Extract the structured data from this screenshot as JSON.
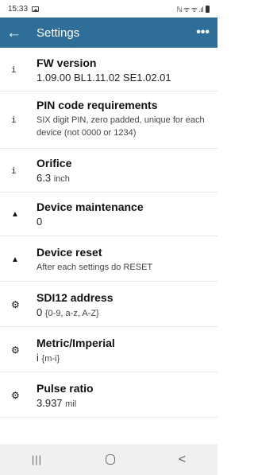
{
  "status_bar": {
    "time": "15:33",
    "right_text": "ℕ ᯤ ᯤ .ıl"
  },
  "app_bar": {
    "back_icon": "arrow-left-icon",
    "title": "Settings",
    "more_icon": "more-dots-icon",
    "more_label": "•••"
  },
  "items": [
    {
      "icon": "info-icon",
      "glyph": "i",
      "title": "FW version",
      "value": "1.09.00 BL1.11.02 SE1.02.01",
      "unit": ""
    },
    {
      "icon": "info-icon",
      "glyph": "i",
      "title": "PIN code requirements",
      "sub": "SIX digit PIN, zero padded, unique for each device (not 0000 or 1234)"
    },
    {
      "icon": "info-icon",
      "glyph": "i",
      "title": "Orifice",
      "value": "6.3",
      "unit": "inch"
    },
    {
      "icon": "warning-icon",
      "glyph": "▲",
      "title": "Device maintenance",
      "value": "0",
      "unit": ""
    },
    {
      "icon": "warning-icon",
      "glyph": "▲",
      "title": "Device reset",
      "sub": "After each settings do RESET"
    },
    {
      "icon": "gear-icon",
      "glyph": "⚙",
      "title": "SDI12 address",
      "value": "0",
      "unit": "{0-9, a-z, A-Z}"
    },
    {
      "icon": "gear-icon",
      "glyph": "⚙",
      "title": "Metric/Imperial",
      "value": "i",
      "unit": "{m-i}"
    },
    {
      "icon": "gear-icon",
      "glyph": "⚙",
      "title": "Pulse ratio",
      "value": "3.937",
      "unit": "mil"
    }
  ],
  "nav_bar": {
    "recent": "|||",
    "back": "<"
  }
}
